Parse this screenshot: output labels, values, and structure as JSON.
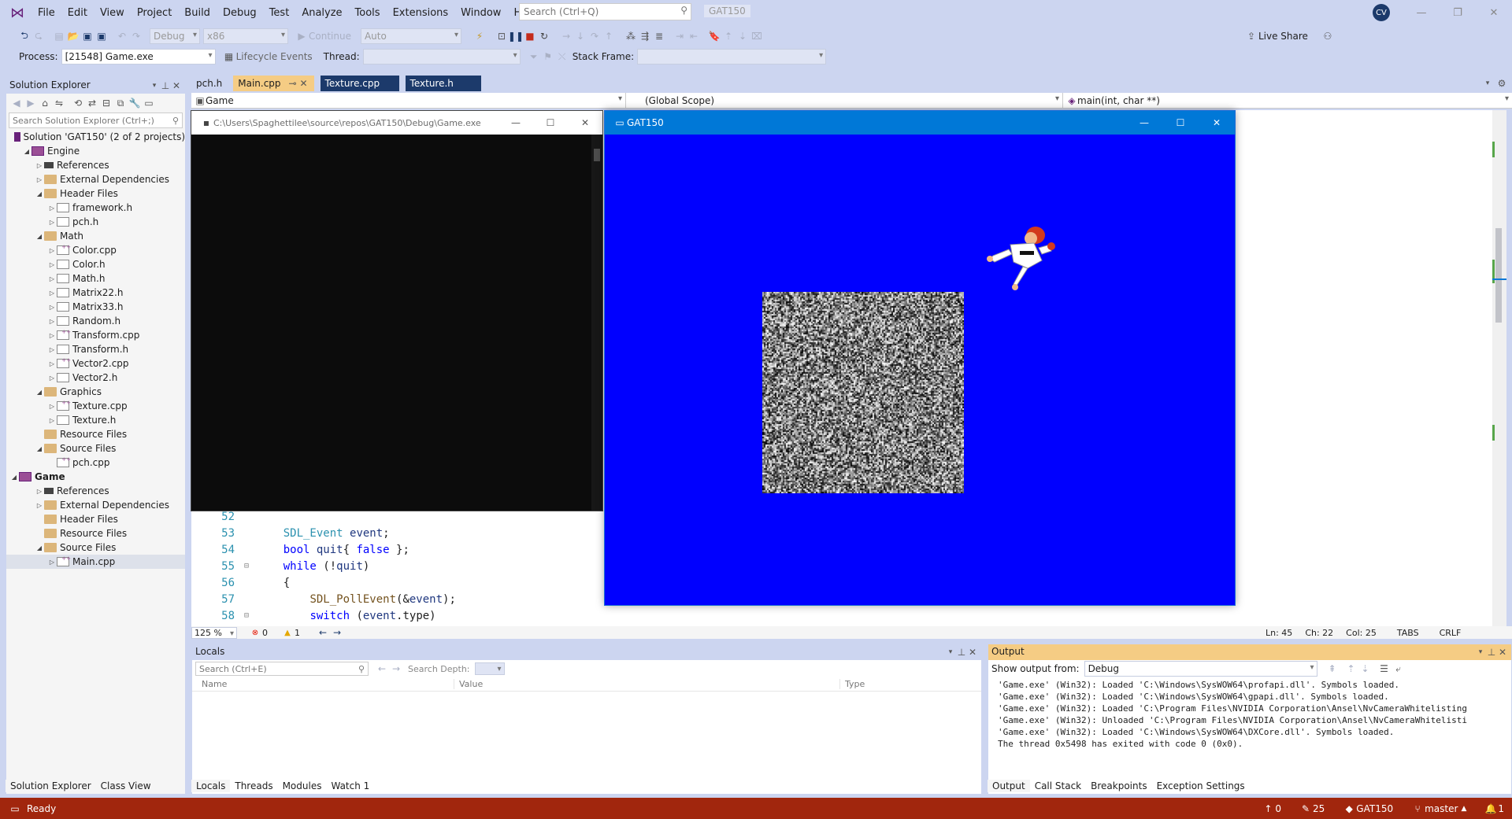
{
  "menu": [
    "File",
    "Edit",
    "View",
    "Project",
    "Build",
    "Debug",
    "Test",
    "Analyze",
    "Tools",
    "Extensions",
    "Window",
    "Help"
  ],
  "search_placeholder": "Search (Ctrl+Q)",
  "solution_name_badge": "GAT150",
  "user_initials": "CV",
  "toolbar": {
    "config": "Debug",
    "platform": "x86",
    "continue": "Continue",
    "auto": "Auto",
    "live_share": "Live Share",
    "process_label": "Process:",
    "process_value": "[21548] Game.exe",
    "lifecycle": "Lifecycle Events",
    "thread_label": "Thread:",
    "stack_frame_label": "Stack Frame:"
  },
  "solution_explorer": {
    "title": "Solution Explorer",
    "search_placeholder": "Search Solution Explorer (Ctrl+;)",
    "tree": [
      {
        "label": "Solution 'GAT150' (2 of 2 projects)",
        "indent": 0,
        "arrow": "",
        "icon": "sln"
      },
      {
        "label": "Engine",
        "indent": 1,
        "arrow": "◢",
        "icon": "proj"
      },
      {
        "label": "References",
        "indent": 2,
        "arrow": "▷",
        "icon": "refs"
      },
      {
        "label": "External Dependencies",
        "indent": 2,
        "arrow": "▷",
        "icon": "fld"
      },
      {
        "label": "Header Files",
        "indent": 2,
        "arrow": "◢",
        "icon": "fld"
      },
      {
        "label": "framework.h",
        "indent": 3,
        "arrow": "▷",
        "icon": "hdr"
      },
      {
        "label": "pch.h",
        "indent": 3,
        "arrow": "▷",
        "icon": "hdr"
      },
      {
        "label": "Math",
        "indent": 2,
        "arrow": "◢",
        "icon": "fld"
      },
      {
        "label": "Color.cpp",
        "indent": 3,
        "arrow": "▷",
        "icon": "cpp"
      },
      {
        "label": "Color.h",
        "indent": 3,
        "arrow": "▷",
        "icon": "hdr"
      },
      {
        "label": "Math.h",
        "indent": 3,
        "arrow": "▷",
        "icon": "hdr"
      },
      {
        "label": "Matrix22.h",
        "indent": 3,
        "arrow": "▷",
        "icon": "hdr"
      },
      {
        "label": "Matrix33.h",
        "indent": 3,
        "arrow": "▷",
        "icon": "hdr"
      },
      {
        "label": "Random.h",
        "indent": 3,
        "arrow": "▷",
        "icon": "hdr"
      },
      {
        "label": "Transform.cpp",
        "indent": 3,
        "arrow": "▷",
        "icon": "cpp"
      },
      {
        "label": "Transform.h",
        "indent": 3,
        "arrow": "▷",
        "icon": "hdr"
      },
      {
        "label": "Vector2.cpp",
        "indent": 3,
        "arrow": "▷",
        "icon": "cpp"
      },
      {
        "label": "Vector2.h",
        "indent": 3,
        "arrow": "▷",
        "icon": "hdr"
      },
      {
        "label": "Graphics",
        "indent": 2,
        "arrow": "◢",
        "icon": "fld"
      },
      {
        "label": "Texture.cpp",
        "indent": 3,
        "arrow": "▷",
        "icon": "cpp"
      },
      {
        "label": "Texture.h",
        "indent": 3,
        "arrow": "▷",
        "icon": "hdr"
      },
      {
        "label": "Resource Files",
        "indent": 2,
        "arrow": "",
        "icon": "fld"
      },
      {
        "label": "Source Files",
        "indent": 2,
        "arrow": "◢",
        "icon": "fld"
      },
      {
        "label": "pch.cpp",
        "indent": 3,
        "arrow": "",
        "icon": "cpp"
      },
      {
        "label": "Game",
        "indent": 0,
        "arrow": "◢",
        "icon": "proj",
        "bold": true
      },
      {
        "label": "References",
        "indent": 2,
        "arrow": "▷",
        "icon": "refs"
      },
      {
        "label": "External Dependencies",
        "indent": 2,
        "arrow": "▷",
        "icon": "fld"
      },
      {
        "label": "Header Files",
        "indent": 2,
        "arrow": "",
        "icon": "fld"
      },
      {
        "label": "Resource Files",
        "indent": 2,
        "arrow": "",
        "icon": "fld"
      },
      {
        "label": "Source Files",
        "indent": 2,
        "arrow": "◢",
        "icon": "fld"
      },
      {
        "label": "Main.cpp",
        "indent": 3,
        "arrow": "▷",
        "icon": "cpp",
        "selected": true
      }
    ],
    "tabs": [
      "Solution Explorer",
      "Class View"
    ]
  },
  "doc_tabs": [
    {
      "label": "pch.h",
      "state": "normal"
    },
    {
      "label": "Main.cpp",
      "state": "active"
    },
    {
      "label": "Texture.cpp",
      "state": "preview"
    },
    {
      "label": "Texture.h",
      "state": "preview"
    }
  ],
  "nav": {
    "project": "Game",
    "scope": "(Global Scope)",
    "member": "main(int, char **)"
  },
  "code_lines": [
    {
      "n": "52",
      "fold": "",
      "html": ""
    },
    {
      "n": "53",
      "fold": "",
      "html": "    <span class='ty'>SDL_Event</span> <span class='vr'>event</span>;"
    },
    {
      "n": "54",
      "fold": "",
      "html": "    <span class='kw'>bool</span> <span class='vr'>quit</span>{ <span class='kw'>false</span> };"
    },
    {
      "n": "55",
      "fold": "⊟",
      "html": "    <span class='kw'>while</span> (!<span class='vr'>quit</span>)"
    },
    {
      "n": "56",
      "fold": "",
      "html": "    {"
    },
    {
      "n": "57",
      "fold": "",
      "html": "        <span class='fn'>SDL_PollEvent</span>(&amp;<span class='vr'>event</span>);"
    },
    {
      "n": "58",
      "fold": "⊟",
      "html": "        <span class='kw'>switch</span> (<span class='vr'>event</span>.type)"
    }
  ],
  "editor_status": {
    "zoom": "125 %",
    "errors": "0",
    "warnings": "1",
    "ln": "Ln: 45",
    "ch": "Ch: 22",
    "col": "Col: 25",
    "tabs": "TABS",
    "crlf": "CRLF"
  },
  "console_window": {
    "title": "C:\\Users\\Spaghettilee\\source\\repos\\GAT150\\Debug\\Game.exe"
  },
  "game_window": {
    "title": "GAT150"
  },
  "locals": {
    "title": "Locals",
    "search_placeholder": "Search (Ctrl+E)",
    "search_depth": "Search Depth:",
    "columns": [
      "Name",
      "Value",
      "Type"
    ],
    "tabs": [
      "Locals",
      "Threads",
      "Modules",
      "Watch 1"
    ]
  },
  "output": {
    "title": "Output",
    "show_from_label": "Show output from:",
    "show_from_value": "Debug",
    "lines": [
      "'Game.exe' (Win32): Loaded 'C:\\Windows\\SysWOW64\\profapi.dll'. Symbols loaded.",
      "'Game.exe' (Win32): Loaded 'C:\\Windows\\SysWOW64\\gpapi.dll'. Symbols loaded.",
      "'Game.exe' (Win32): Loaded 'C:\\Program Files\\NVIDIA Corporation\\Ansel\\NvCameraWhitelisting",
      "'Game.exe' (Win32): Unloaded 'C:\\Program Files\\NVIDIA Corporation\\Ansel\\NvCameraWhitelisti",
      "'Game.exe' (Win32): Loaded 'C:\\Windows\\SysWOW64\\DXCore.dll'. Symbols loaded.",
      "The thread 0x5498 has exited with code 0 (0x0)."
    ],
    "tabs": [
      "Output",
      "Call Stack",
      "Breakpoints",
      "Exception Settings"
    ]
  },
  "status": {
    "ready": "Ready",
    "up": "0",
    "edits": "25",
    "repo": "GAT150",
    "branch": "master",
    "bell": "1"
  }
}
